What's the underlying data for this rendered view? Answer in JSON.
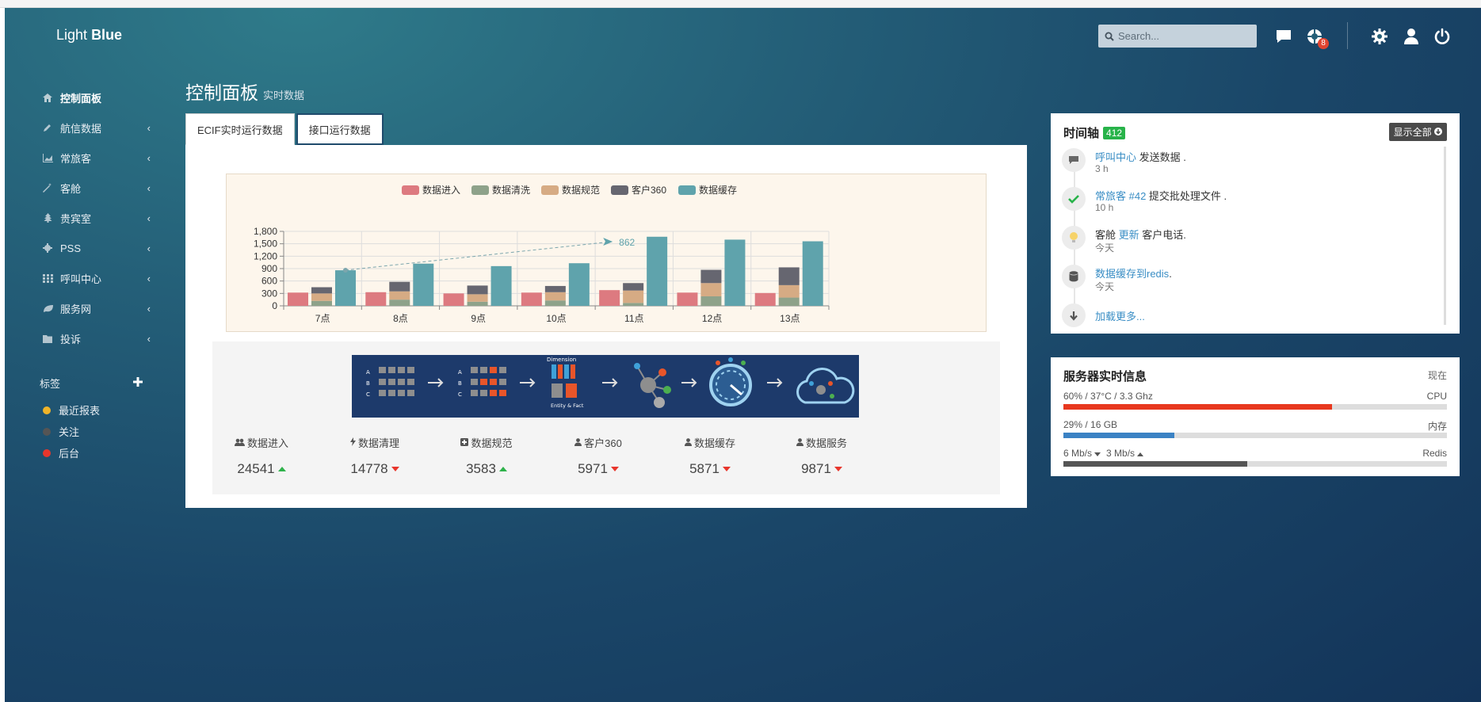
{
  "brand": {
    "light": "Light",
    "bold": "Blue"
  },
  "header": {
    "search_placeholder": "Search...",
    "notification_count": "8"
  },
  "sidebar": {
    "items": [
      {
        "label": "控制面板",
        "icon": "home-icon",
        "active": true
      },
      {
        "label": "航信数据",
        "icon": "pencil-icon"
      },
      {
        "label": "常旅客",
        "icon": "chart-icon"
      },
      {
        "label": "客舱",
        "icon": "magic-wand-icon"
      },
      {
        "label": "贵宾室",
        "icon": "tree-icon"
      },
      {
        "label": "PSS",
        "icon": "gear-icon"
      },
      {
        "label": "呼叫中心",
        "icon": "grid-icon"
      },
      {
        "label": "服务网",
        "icon": "leaf-icon"
      },
      {
        "label": "投诉",
        "icon": "folder-icon"
      }
    ],
    "tags_title": "标签",
    "tags": [
      {
        "label": "最近报表",
        "color": "#f0b429"
      },
      {
        "label": "关注",
        "color": "#555555"
      },
      {
        "label": "后台",
        "color": "#e8362c"
      }
    ]
  },
  "page": {
    "title": "控制面板",
    "subtitle": "实时数据"
  },
  "tabs": [
    {
      "label": "ECIF实时运行数据",
      "active": true
    },
    {
      "label": "接口运行数据",
      "active": false
    }
  ],
  "chart_data": {
    "type": "bar",
    "categories": [
      "7点",
      "8点",
      "9点",
      "10点",
      "11点",
      "12点",
      "13点"
    ],
    "series": [
      {
        "name": "数据进入",
        "color": "#dd7a80",
        "values": [
          320,
          330,
          300,
          320,
          380,
          320,
          310
        ]
      },
      {
        "name": "数据清洗",
        "color": "#8ea28a",
        "values": [
          120,
          150,
          100,
          130,
          70,
          230,
          200
        ]
      },
      {
        "name": "数据规范",
        "color": "#d6ab84",
        "values": [
          180,
          200,
          180,
          200,
          300,
          320,
          300
        ]
      },
      {
        "name": "客户360",
        "color": "#666670",
        "values": [
          150,
          230,
          210,
          150,
          180,
          320,
          430
        ]
      },
      {
        "name": "数据缓存",
        "color": "#5fa3ac",
        "values": [
          860,
          1020,
          960,
          1030,
          1670,
          1600,
          1560
        ]
      }
    ],
    "stacked_series": [
      "数据清洗",
      "数据规范",
      "客户360"
    ],
    "yticks": [
      "0",
      "300",
      "600",
      "900",
      "1,200",
      "1,500",
      "1,800"
    ],
    "ylim": [
      0,
      1800
    ],
    "trend_label": "862",
    "trend": {
      "from_category": "7点",
      "from_value": 862,
      "to_category": "11点",
      "to_value": 1550
    }
  },
  "pipeline": {
    "dimension_label": "Dimension",
    "entity_label": "Entity & Fact"
  },
  "stats": [
    {
      "label": "数据进入",
      "value": "24541",
      "trend": "up",
      "icon": "users-icon"
    },
    {
      "label": "数据清理",
      "value": "14778",
      "trend": "down",
      "icon": "bolt-icon"
    },
    {
      "label": "数据规范",
      "value": "3583",
      "trend": "up",
      "icon": "plus-square-icon"
    },
    {
      "label": "客户360",
      "value": "5971",
      "trend": "down",
      "icon": "user-icon"
    },
    {
      "label": "数据缓存",
      "value": "5871",
      "trend": "down",
      "icon": "user-icon"
    },
    {
      "label": "数据服务",
      "value": "9871",
      "trend": "down",
      "icon": "user-icon"
    }
  ],
  "timeline": {
    "title": "时间轴",
    "count": "412",
    "show_all": "显示全部",
    "items": [
      {
        "icon": "comment-icon",
        "link": "呼叫中心",
        "pre": "",
        "text": " 发送数据 .",
        "time": "3 h"
      },
      {
        "icon": "check-icon",
        "link": "常旅客 #42",
        "pre": "",
        "text": " 提交批处理文件 .",
        "time": "10 h"
      },
      {
        "icon": "bulb-icon",
        "link": "更新",
        "pre": "客舱 ",
        "text": " 客户电话.",
        "time": "今天"
      },
      {
        "icon": "database-icon",
        "link": "数据缓存到redis",
        "pre": "",
        "text": ".",
        "time": "今天"
      }
    ],
    "load_more": "加载更多..."
  },
  "server": {
    "title": "服务器实时信息",
    "now": "现在",
    "rows": [
      {
        "left": "60% / 37°C / 3.3 Ghz",
        "right": "CPU",
        "value": 0.7,
        "color": "#e8381f"
      },
      {
        "left": "29% / 16 GB",
        "right": "内存",
        "value": 0.29,
        "color": "#3a82c4"
      },
      {
        "left_a": "6 Mb/s",
        "left_b": "3 Mb/s",
        "right": "Redis",
        "value": 0.48,
        "color": "#555555"
      }
    ]
  }
}
